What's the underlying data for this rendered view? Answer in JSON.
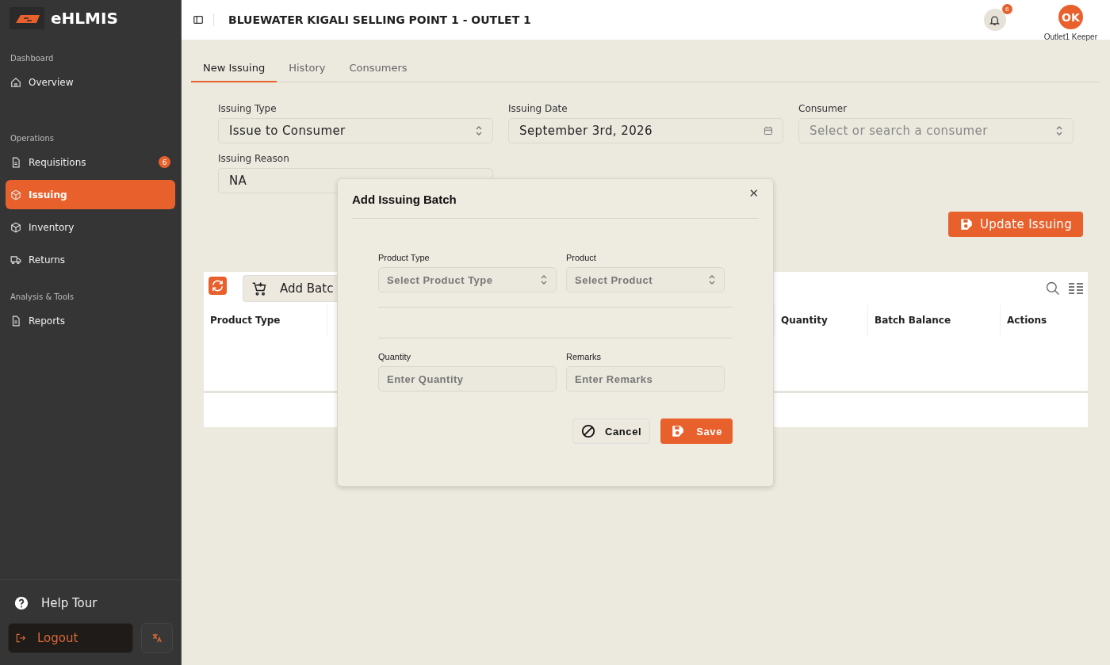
{
  "app": {
    "name": "eHLMIS"
  },
  "sidebar": {
    "sections": [
      {
        "label": "Dashboard",
        "items": [
          {
            "label": "Overview",
            "selected": false
          }
        ]
      },
      {
        "label": "Operations",
        "items": [
          {
            "label": "Requisitions",
            "badge": "6",
            "selected": false
          },
          {
            "label": "Issuing",
            "selected": true
          },
          {
            "label": "Inventory",
            "selected": false
          },
          {
            "label": "Returns",
            "selected": false
          }
        ]
      },
      {
        "label": "Analysis & Tools",
        "items": [
          {
            "label": "Reports",
            "selected": false
          }
        ]
      }
    ],
    "help": "Help Tour",
    "logout": "Logout"
  },
  "header": {
    "title": "BLUEWATER KIGALI SELLING POINT 1 - OUTLET 1",
    "notifications": "6",
    "avatar": "OK",
    "user": "Outlet1 Keeper"
  },
  "tabs": [
    {
      "label": "New Issuing",
      "selected": true
    },
    {
      "label": "History",
      "selected": false
    },
    {
      "label": "Consumers",
      "selected": false
    }
  ],
  "form": {
    "fields": [
      {
        "label": "Issuing Type",
        "kind": "select",
        "value": "Issue to Consumer"
      },
      {
        "label": "Issuing Date",
        "kind": "date",
        "value": "September 3rd, 2026"
      },
      {
        "label": "Consumer",
        "kind": "select",
        "placeholder": "Select or search a consumer"
      },
      {
        "label": "Issuing Reason",
        "kind": "text",
        "value": "NA"
      }
    ],
    "submit": "Update Issuing"
  },
  "table": {
    "add_button": "Add Batc",
    "columns": [
      "Product Type",
      "Quantity",
      "Batch Balance",
      "Actions"
    ]
  },
  "dialog": {
    "title": "Add Issuing Batch",
    "close": "✕",
    "selects": [
      {
        "label": "Product Type",
        "placeholder": "Select Product Type"
      },
      {
        "label": "Product",
        "placeholder": "Select Product"
      }
    ],
    "inputs": [
      {
        "label": "Quantity",
        "placeholder": "Enter Quantity"
      },
      {
        "label": "Remarks",
        "placeholder": "Enter Remarks"
      }
    ],
    "cancel": "Cancel",
    "save": "Save"
  }
}
